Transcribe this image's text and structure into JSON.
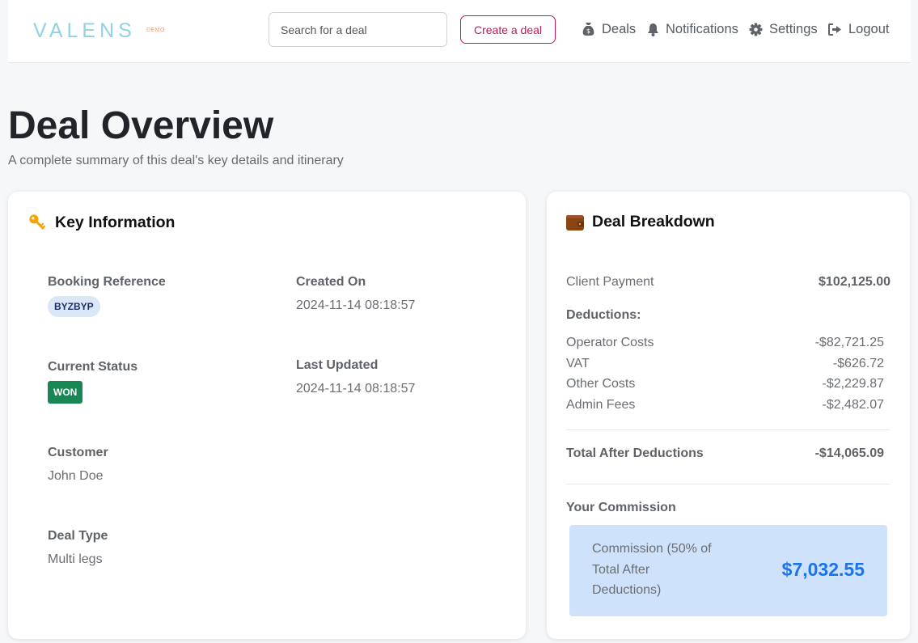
{
  "brand": {
    "logo": "VALENS",
    "tag": "DEMO"
  },
  "search": {
    "placeholder": "Search for a deal"
  },
  "nav": {
    "create_label": "Create a deal",
    "links": [
      {
        "label": "Deals",
        "icon": "money-bag-icon"
      },
      {
        "label": "Notifications",
        "icon": "bell-icon"
      },
      {
        "label": "Settings",
        "icon": "gear-icon"
      },
      {
        "label": "Logout",
        "icon": "logout-icon"
      }
    ]
  },
  "page": {
    "title": "Deal Overview",
    "subtitle": "A complete summary of this deal's key details and itinerary"
  },
  "key_info": {
    "title": "Key Information",
    "icon": "key-icon",
    "booking_reference": {
      "label": "Booking Reference",
      "value": "BYZBYP"
    },
    "created_on": {
      "label": "Created On",
      "value": "2024-11-14 08:18:57"
    },
    "current_status": {
      "label": "Current Status",
      "value": "WON"
    },
    "last_updated": {
      "label": "Last Updated",
      "value": "2024-11-14 08:18:57"
    },
    "customer": {
      "label": "Customer",
      "value": "John Doe"
    },
    "deal_type": {
      "label": "Deal Type",
      "value": "Multi legs"
    }
  },
  "breakdown": {
    "title": "Deal Breakdown",
    "icon": "wallet-icon",
    "client_payment": {
      "label": "Client Payment",
      "value": "$102,125.00"
    },
    "deductions_label": "Deductions:",
    "deductions": [
      {
        "label": "Operator Costs",
        "value": "-$82,721.25"
      },
      {
        "label": "VAT",
        "value": "-$626.72"
      },
      {
        "label": "Other Costs",
        "value": "-$2,229.87"
      },
      {
        "label": "Admin Fees",
        "value": "-$2,482.07"
      }
    ],
    "total": {
      "label": "Total After Deductions",
      "value": "-$14,065.09"
    },
    "commission_label": "Your Commission",
    "commission": {
      "text": "Commission (50% of Total After Deductions)",
      "value": "$7,032.55"
    }
  },
  "colors": {
    "accent": "#c2185b",
    "status_won": "#198754",
    "commission_bg": "#cfe2fb",
    "commission_amount": "#1a73e8",
    "logo": "#8fd3e4"
  }
}
